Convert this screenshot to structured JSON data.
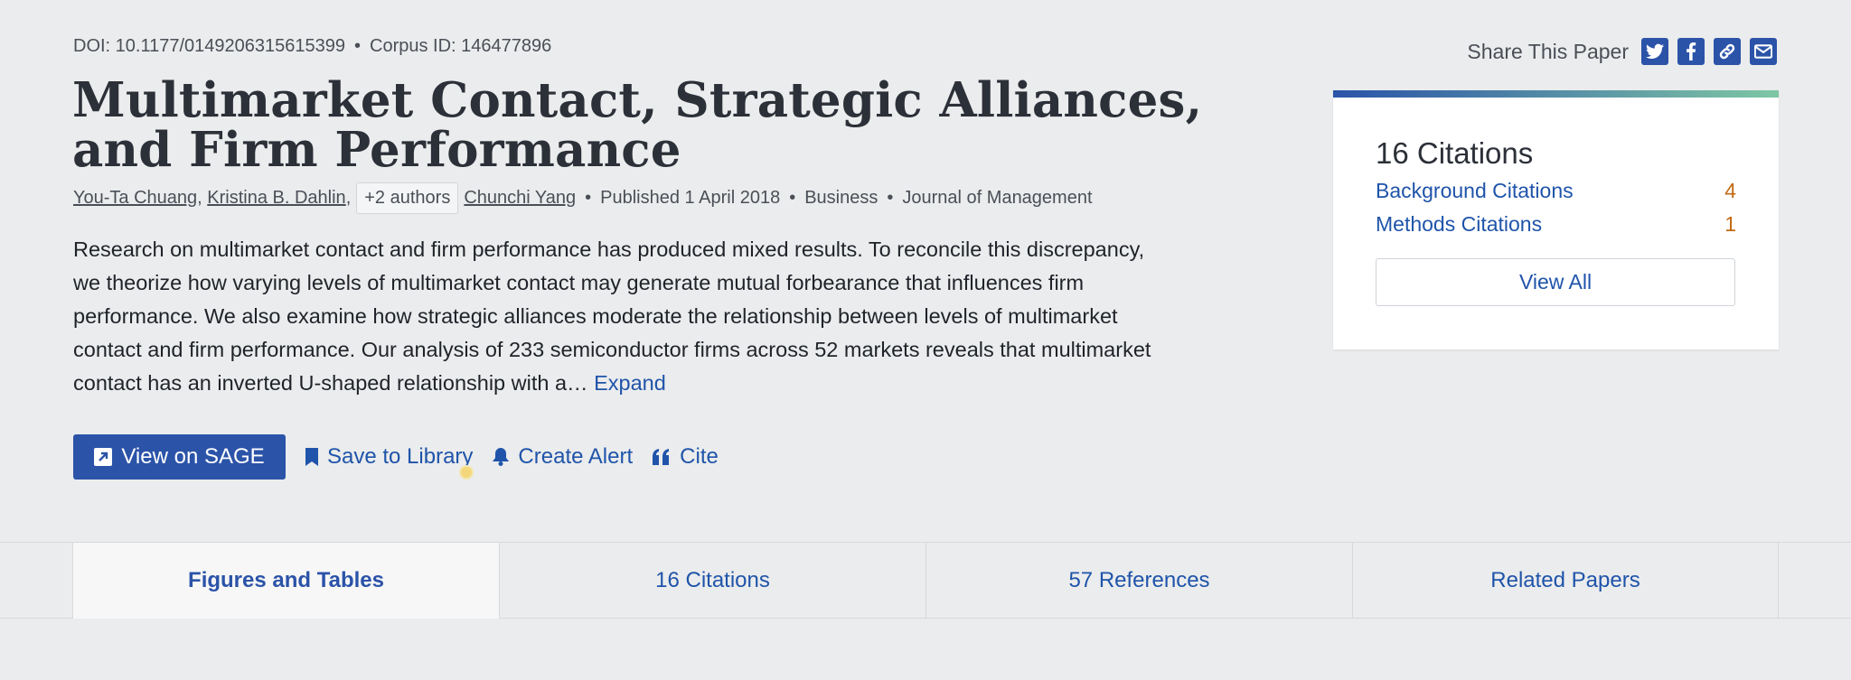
{
  "meta": {
    "doi": "DOI: 10.1177/0149206315615399",
    "separator": "•",
    "corpus_id": "Corpus ID: 146477896"
  },
  "paper": {
    "title": "Multimarket Contact, Strategic Alliances, and Firm Performance",
    "authors": [
      {
        "name": "You-Ta Chuang"
      },
      {
        "name": "Kristina B. Dahlin"
      },
      {
        "name": "Chunchi Yang"
      }
    ],
    "more_authors": "+2 authors",
    "published": "Published 1 April 2018",
    "field": "Business",
    "venue": "Journal of Management",
    "abstract": "Research on multimarket contact and firm performance has produced mixed results. To reconcile this discrepancy, we theorize how varying levels of multimarket contact may generate mutual forbearance that influences firm performance. We also examine how strategic alliances moderate the relationship between levels of multimarket contact and firm performance. Our analysis of 233 semiconductor firms across 52 markets reveals that multimarket contact has an inverted U-shaped relationship with a…",
    "expand_label": "Expand"
  },
  "actions": {
    "view_on": "View on SAGE",
    "save": "Save to Library",
    "alert": "Create Alert",
    "cite": "Cite"
  },
  "share": {
    "label": "Share This Paper",
    "icons": [
      "twitter-icon",
      "facebook-icon",
      "link-icon",
      "email-icon"
    ]
  },
  "citations_card": {
    "title": "16 Citations",
    "rows": [
      {
        "label": "Background Citations",
        "count": "4"
      },
      {
        "label": "Methods Citations",
        "count": "1"
      }
    ],
    "view_all": "View All"
  },
  "tabs": [
    {
      "label": "Figures and Tables",
      "active": true
    },
    {
      "label": "16 Citations"
    },
    {
      "label": "57 References"
    },
    {
      "label": "Related Papers"
    }
  ],
  "colors": {
    "accent": "#2b53a8",
    "link": "#1f54aa",
    "count": "#c36a12",
    "background": "#ebeced"
  }
}
